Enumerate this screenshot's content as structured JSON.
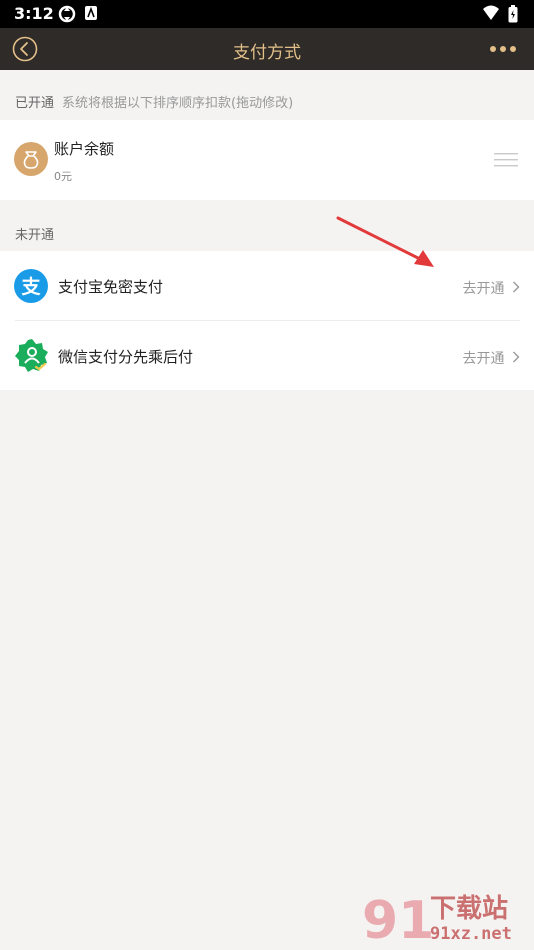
{
  "status_bar": {
    "time": "3:12"
  },
  "header": {
    "title": "支付方式"
  },
  "enabled_section": {
    "title": "已开通",
    "hint": "系统将根据以下排序顺序扣款(拖动修改)",
    "items": [
      {
        "label": "账户余额",
        "subtext": "0元"
      }
    ]
  },
  "disabled_section": {
    "title": "未开通",
    "items": [
      {
        "label": "支付宝免密支付",
        "action": "去开通"
      },
      {
        "label": "微信支付分先乘后付",
        "action": "去开通"
      }
    ]
  },
  "watermark": {
    "text_top": "下载站",
    "text_bottom": "91xz.net"
  },
  "colors": {
    "header_bg": "#2f2b28",
    "title_gold": "#e3c08a",
    "alipay_blue": "#1a9be8",
    "wechat_green": "#1aad5b",
    "balance_gold": "#d7a66c"
  }
}
